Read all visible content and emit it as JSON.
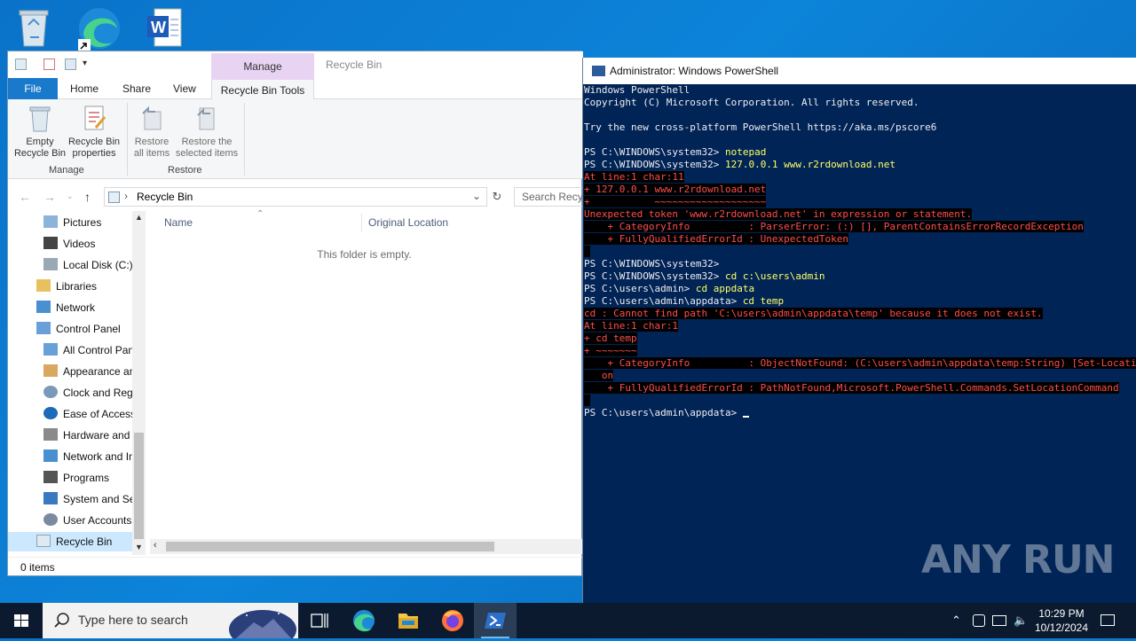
{
  "explorer": {
    "context_tab": "Manage",
    "window_title": "Recycle Bin",
    "tabs": [
      "File",
      "Home",
      "Share",
      "View",
      "Recycle Bin Tools"
    ],
    "ribbon": {
      "empty": [
        "Empty",
        "Recycle Bin"
      ],
      "properties": [
        "Recycle Bin",
        "properties"
      ],
      "restore_all": [
        "Restore",
        "all items"
      ],
      "restore_selected": [
        "Restore the",
        "selected items"
      ],
      "group_manage": "Manage",
      "group_restore": "Restore"
    },
    "address": "Recycle Bin",
    "search_placeholder": "Search Recycle Bin",
    "nav_items": [
      "Pictures",
      "Videos",
      "Local Disk (C:)",
      "Libraries",
      "Network",
      "Control Panel",
      "All Control Panel Items",
      "Appearance and Personalization",
      "Clock and Region",
      "Ease of Access",
      "Hardware and Sound",
      "Network and Internet",
      "Programs",
      "System and Security",
      "User Accounts",
      "Recycle Bin"
    ],
    "columns": [
      "Name",
      "Original Location"
    ],
    "empty_message": "This folder is empty.",
    "status": "0 items"
  },
  "powershell": {
    "title": "Administrator: Windows PowerShell",
    "lines": [
      {
        "t": "Windows PowerShell",
        "c": "n"
      },
      {
        "t": "Copyright (C) Microsoft Corporation. All rights reserved.",
        "c": "n"
      },
      {
        "t": "",
        "c": "n"
      },
      {
        "t": "Try the new cross-platform PowerShell https://aka.ms/pscore6",
        "c": "n"
      },
      {
        "t": "",
        "c": "n"
      },
      {
        "t": "PS C:\\WINDOWS\\system32> ",
        "cmd": "notepad"
      },
      {
        "t": "PS C:\\WINDOWS\\system32> ",
        "cmd": "127.0.0.1 www.r2rdownload.net"
      },
      {
        "t": "At line:1 char:11",
        "c": "e"
      },
      {
        "t": "+ 127.0.0.1 www.r2rdownload.net",
        "c": "e"
      },
      {
        "t": "+           ~~~~~~~~~~~~~~~~~~~",
        "c": "e"
      },
      {
        "t": "Unexpected token 'www.r2rdownload.net' in expression or statement.",
        "c": "e"
      },
      {
        "t": "    + CategoryInfo          : ParserError: (:) [], ParentContainsErrorRecordException",
        "c": "e"
      },
      {
        "t": "    + FullyQualifiedErrorId : UnexpectedToken",
        "c": "e"
      },
      {
        "t": " ",
        "c": "e"
      },
      {
        "t": "PS C:\\WINDOWS\\system32>",
        "c": "n"
      },
      {
        "t": "PS C:\\WINDOWS\\system32> ",
        "cmd": "cd c:\\users\\admin"
      },
      {
        "t": "PS C:\\users\\admin> ",
        "cmd": "cd appdata"
      },
      {
        "t": "PS C:\\users\\admin\\appdata> ",
        "cmd": "cd temp"
      },
      {
        "t": "cd : Cannot find path 'C:\\users\\admin\\appdata\\temp' because it does not exist.",
        "c": "e"
      },
      {
        "t": "At line:1 char:1",
        "c": "e"
      },
      {
        "t": "+ cd temp",
        "c": "e"
      },
      {
        "t": "+ ~~~~~~~",
        "c": "e"
      },
      {
        "t": "    + CategoryInfo          : ObjectNotFound: (C:\\users\\admin\\appdata\\temp:String) [Set-Location], ItemNotFoundException",
        "c": "e"
      },
      {
        "t": "   on",
        "c": "e"
      },
      {
        "t": "    + FullyQualifiedErrorId : PathNotFound,Microsoft.PowerShell.Commands.SetLocationCommand",
        "c": "e"
      },
      {
        "t": " ",
        "c": "e"
      },
      {
        "t": "PS C:\\users\\admin\\appdata> ",
        "c": "p"
      }
    ]
  },
  "watermark": "ANY RUN",
  "taskbar": {
    "search_placeholder": "Type here to search",
    "time": "10:29 PM",
    "date": "10/12/2024"
  }
}
